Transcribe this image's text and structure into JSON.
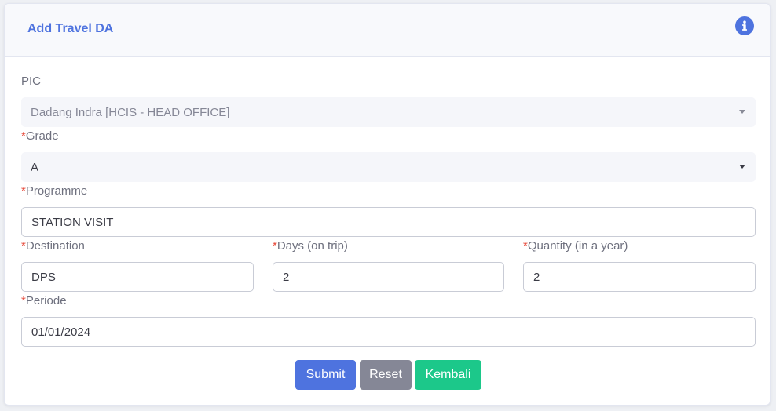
{
  "header": {
    "title": "Add Travel DA",
    "icon": "info-icon"
  },
  "form": {
    "pic": {
      "label": "PIC",
      "value": "Dadang Indra [HCIS - HEAD OFFICE]"
    },
    "grade": {
      "required_mark": "*",
      "label": "Grade",
      "value": "A"
    },
    "programme": {
      "required_mark": "*",
      "label": "Programme",
      "value": "STATION VISIT"
    },
    "destination": {
      "required_mark": "*",
      "label": "Destination",
      "value": "DPS"
    },
    "days": {
      "required_mark": "*",
      "label": "Days (on trip)",
      "value": "2"
    },
    "quantity": {
      "required_mark": "*",
      "label": "Quantity (in a year)",
      "value": "2"
    },
    "periode": {
      "required_mark": "*",
      "label": "Periode",
      "value": "01/01/2024"
    }
  },
  "buttons": {
    "submit": "Submit",
    "reset": "Reset",
    "back": "Kembali"
  },
  "colors": {
    "primary": "#4e73df",
    "secondary": "#858796",
    "success": "#1cc88a",
    "required": "#e74a3b"
  }
}
